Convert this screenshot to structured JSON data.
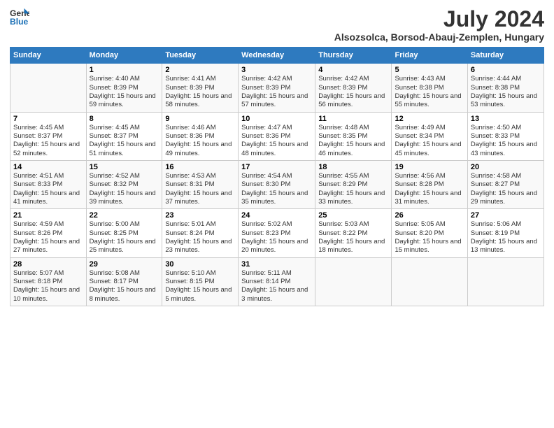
{
  "header": {
    "logo_line1": "General",
    "logo_line2": "Blue",
    "main_title": "July 2024",
    "subtitle": "Alsozsolca, Borsod-Abauj-Zemplen, Hungary"
  },
  "days_of_week": [
    "Sunday",
    "Monday",
    "Tuesday",
    "Wednesday",
    "Thursday",
    "Friday",
    "Saturday"
  ],
  "weeks": [
    [
      {
        "day": "",
        "sunrise": "",
        "sunset": "",
        "daylight": ""
      },
      {
        "day": "1",
        "sunrise": "Sunrise: 4:40 AM",
        "sunset": "Sunset: 8:39 PM",
        "daylight": "Daylight: 15 hours and 59 minutes."
      },
      {
        "day": "2",
        "sunrise": "Sunrise: 4:41 AM",
        "sunset": "Sunset: 8:39 PM",
        "daylight": "Daylight: 15 hours and 58 minutes."
      },
      {
        "day": "3",
        "sunrise": "Sunrise: 4:42 AM",
        "sunset": "Sunset: 8:39 PM",
        "daylight": "Daylight: 15 hours and 57 minutes."
      },
      {
        "day": "4",
        "sunrise": "Sunrise: 4:42 AM",
        "sunset": "Sunset: 8:39 PM",
        "daylight": "Daylight: 15 hours and 56 minutes."
      },
      {
        "day": "5",
        "sunrise": "Sunrise: 4:43 AM",
        "sunset": "Sunset: 8:38 PM",
        "daylight": "Daylight: 15 hours and 55 minutes."
      },
      {
        "day": "6",
        "sunrise": "Sunrise: 4:44 AM",
        "sunset": "Sunset: 8:38 PM",
        "daylight": "Daylight: 15 hours and 53 minutes."
      }
    ],
    [
      {
        "day": "7",
        "sunrise": "Sunrise: 4:45 AM",
        "sunset": "Sunset: 8:37 PM",
        "daylight": "Daylight: 15 hours and 52 minutes."
      },
      {
        "day": "8",
        "sunrise": "Sunrise: 4:45 AM",
        "sunset": "Sunset: 8:37 PM",
        "daylight": "Daylight: 15 hours and 51 minutes."
      },
      {
        "day": "9",
        "sunrise": "Sunrise: 4:46 AM",
        "sunset": "Sunset: 8:36 PM",
        "daylight": "Daylight: 15 hours and 49 minutes."
      },
      {
        "day": "10",
        "sunrise": "Sunrise: 4:47 AM",
        "sunset": "Sunset: 8:36 PM",
        "daylight": "Daylight: 15 hours and 48 minutes."
      },
      {
        "day": "11",
        "sunrise": "Sunrise: 4:48 AM",
        "sunset": "Sunset: 8:35 PM",
        "daylight": "Daylight: 15 hours and 46 minutes."
      },
      {
        "day": "12",
        "sunrise": "Sunrise: 4:49 AM",
        "sunset": "Sunset: 8:34 PM",
        "daylight": "Daylight: 15 hours and 45 minutes."
      },
      {
        "day": "13",
        "sunrise": "Sunrise: 4:50 AM",
        "sunset": "Sunset: 8:33 PM",
        "daylight": "Daylight: 15 hours and 43 minutes."
      }
    ],
    [
      {
        "day": "14",
        "sunrise": "Sunrise: 4:51 AM",
        "sunset": "Sunset: 8:33 PM",
        "daylight": "Daylight: 15 hours and 41 minutes."
      },
      {
        "day": "15",
        "sunrise": "Sunrise: 4:52 AM",
        "sunset": "Sunset: 8:32 PM",
        "daylight": "Daylight: 15 hours and 39 minutes."
      },
      {
        "day": "16",
        "sunrise": "Sunrise: 4:53 AM",
        "sunset": "Sunset: 8:31 PM",
        "daylight": "Daylight: 15 hours and 37 minutes."
      },
      {
        "day": "17",
        "sunrise": "Sunrise: 4:54 AM",
        "sunset": "Sunset: 8:30 PM",
        "daylight": "Daylight: 15 hours and 35 minutes."
      },
      {
        "day": "18",
        "sunrise": "Sunrise: 4:55 AM",
        "sunset": "Sunset: 8:29 PM",
        "daylight": "Daylight: 15 hours and 33 minutes."
      },
      {
        "day": "19",
        "sunrise": "Sunrise: 4:56 AM",
        "sunset": "Sunset: 8:28 PM",
        "daylight": "Daylight: 15 hours and 31 minutes."
      },
      {
        "day": "20",
        "sunrise": "Sunrise: 4:58 AM",
        "sunset": "Sunset: 8:27 PM",
        "daylight": "Daylight: 15 hours and 29 minutes."
      }
    ],
    [
      {
        "day": "21",
        "sunrise": "Sunrise: 4:59 AM",
        "sunset": "Sunset: 8:26 PM",
        "daylight": "Daylight: 15 hours and 27 minutes."
      },
      {
        "day": "22",
        "sunrise": "Sunrise: 5:00 AM",
        "sunset": "Sunset: 8:25 PM",
        "daylight": "Daylight: 15 hours and 25 minutes."
      },
      {
        "day": "23",
        "sunrise": "Sunrise: 5:01 AM",
        "sunset": "Sunset: 8:24 PM",
        "daylight": "Daylight: 15 hours and 23 minutes."
      },
      {
        "day": "24",
        "sunrise": "Sunrise: 5:02 AM",
        "sunset": "Sunset: 8:23 PM",
        "daylight": "Daylight: 15 hours and 20 minutes."
      },
      {
        "day": "25",
        "sunrise": "Sunrise: 5:03 AM",
        "sunset": "Sunset: 8:22 PM",
        "daylight": "Daylight: 15 hours and 18 minutes."
      },
      {
        "day": "26",
        "sunrise": "Sunrise: 5:05 AM",
        "sunset": "Sunset: 8:20 PM",
        "daylight": "Daylight: 15 hours and 15 minutes."
      },
      {
        "day": "27",
        "sunrise": "Sunrise: 5:06 AM",
        "sunset": "Sunset: 8:19 PM",
        "daylight": "Daylight: 15 hours and 13 minutes."
      }
    ],
    [
      {
        "day": "28",
        "sunrise": "Sunrise: 5:07 AM",
        "sunset": "Sunset: 8:18 PM",
        "daylight": "Daylight: 15 hours and 10 minutes."
      },
      {
        "day": "29",
        "sunrise": "Sunrise: 5:08 AM",
        "sunset": "Sunset: 8:17 PM",
        "daylight": "Daylight: 15 hours and 8 minutes."
      },
      {
        "day": "30",
        "sunrise": "Sunrise: 5:10 AM",
        "sunset": "Sunset: 8:15 PM",
        "daylight": "Daylight: 15 hours and 5 minutes."
      },
      {
        "day": "31",
        "sunrise": "Sunrise: 5:11 AM",
        "sunset": "Sunset: 8:14 PM",
        "daylight": "Daylight: 15 hours and 3 minutes."
      },
      {
        "day": "",
        "sunrise": "",
        "sunset": "",
        "daylight": ""
      },
      {
        "day": "",
        "sunrise": "",
        "sunset": "",
        "daylight": ""
      },
      {
        "day": "",
        "sunrise": "",
        "sunset": "",
        "daylight": ""
      }
    ]
  ]
}
